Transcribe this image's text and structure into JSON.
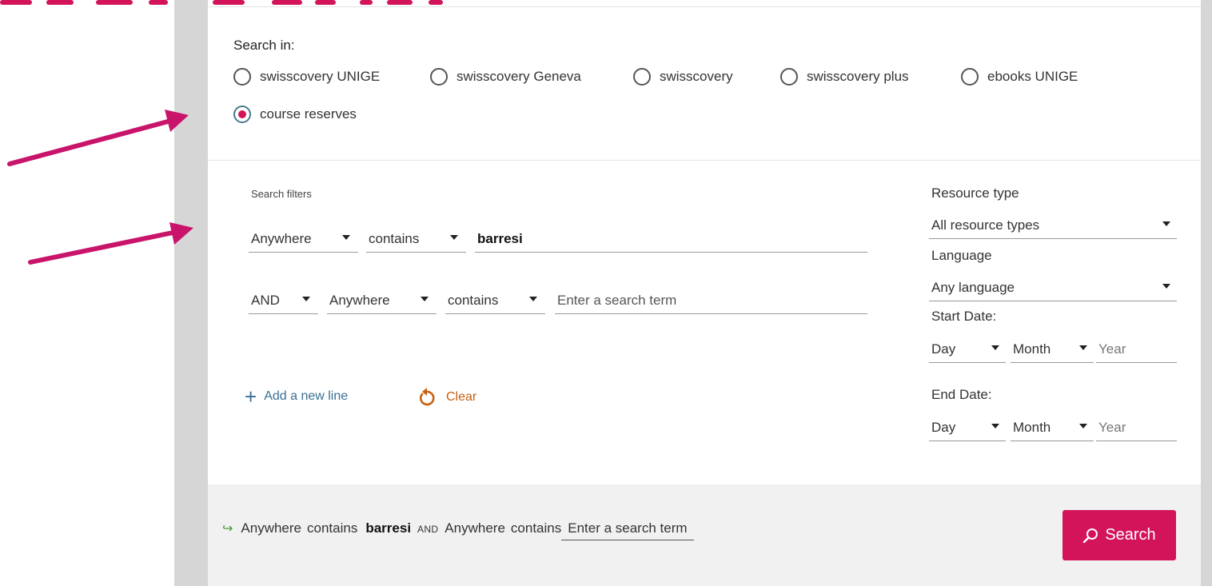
{
  "search_in": {
    "label": "Search in:",
    "options": [
      {
        "label": "swisscovery UNIGE",
        "checked": false
      },
      {
        "label": "swisscovery Geneva",
        "checked": false
      },
      {
        "label": "swisscovery",
        "checked": false
      },
      {
        "label": "swisscovery plus",
        "checked": false
      },
      {
        "label": "ebooks UNIGE",
        "checked": false
      },
      {
        "label": "course reserves",
        "checked": true
      }
    ]
  },
  "filters": {
    "label": "Search filters",
    "line1": {
      "field": "Anywhere",
      "operator": "contains",
      "term": "barresi"
    },
    "line2": {
      "boolean": "AND",
      "field": "Anywhere",
      "operator": "contains",
      "placeholder": "Enter a search term"
    },
    "add_line": "Add a new line",
    "clear": "Clear"
  },
  "right_panel": {
    "resource_type_label": "Resource type",
    "resource_type_value": "All resource types",
    "language_label": "Language",
    "language_value": "Any language",
    "start_date_label": "Start Date:",
    "end_date_label": "End Date:",
    "day": "Day",
    "month": "Month",
    "year": "Year"
  },
  "summary": {
    "field1": "Anywhere",
    "op1": "contains",
    "term1": "barresi",
    "boolean": "AND",
    "field2": "Anywhere",
    "op2": "contains",
    "term2": "Enter a search term"
  },
  "search_button": "Search",
  "colors": {
    "accent": "#d3145a",
    "link": "#3a6f95",
    "clear": "#c95f10",
    "summary_arrow": "#4a9a3a"
  },
  "icons": {
    "add": "plus-icon",
    "clear": "undo-icon",
    "search": "search-icon",
    "summary": "arrow-right-icon",
    "caret": "caret-down-icon"
  }
}
